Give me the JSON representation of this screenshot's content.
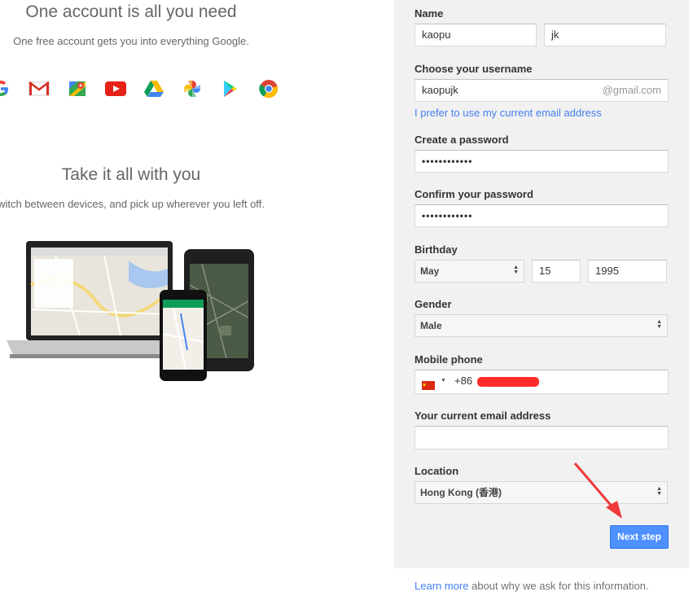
{
  "intro": {
    "title": "One account is all you need",
    "subtitle": "One free account gets you into everything Google.",
    "icons": [
      "google-icon",
      "gmail-icon",
      "maps-icon",
      "youtube-icon",
      "drive-icon",
      "photos-icon",
      "play-icon",
      "chrome-icon"
    ],
    "devices_title": "Take it all with you",
    "devices_subtitle": "witch between devices, and pick up wherever you left off."
  },
  "form": {
    "name_label": "Name",
    "first_name": "kaopu",
    "last_name": "jk",
    "username_label": "Choose your username",
    "username": "kaopujk",
    "gmail_suffix": "@gmail.com",
    "current_email_link": "I prefer to use my current email address",
    "password_label": "Create a password",
    "password_mask": "••••••••••••",
    "confirm_label": "Confirm your password",
    "confirm_mask": "••••••••••••",
    "birthday_label": "Birthday",
    "birth_month": "May",
    "birth_day": "15",
    "birth_year": "1995",
    "gender_label": "Gender",
    "gender": "Male",
    "phone_label": "Mobile phone",
    "phone_code": "+86",
    "current_email_label": "Your current email address",
    "current_email": "",
    "location_label": "Location",
    "location": "Hong Kong (香港)",
    "next_button": "Next step"
  },
  "footer": {
    "learn_more": "Learn more",
    "rest": " about why we ask for this information."
  },
  "colors": {
    "panel_bg": "#f1f1f1",
    "link": "#427fed",
    "button": "#4d90fe",
    "annotation": "#f03a3a"
  }
}
